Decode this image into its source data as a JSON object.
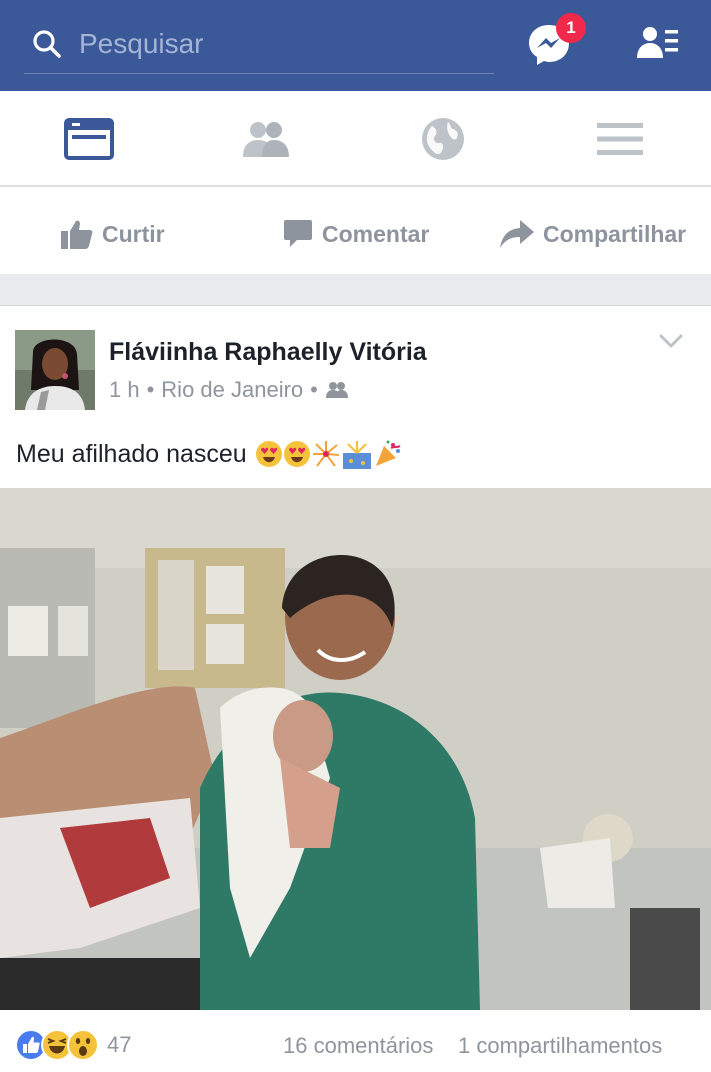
{
  "search": {
    "placeholder": "Pesquisar"
  },
  "header": {
    "messenger_badge": "1"
  },
  "nav": {
    "tabs": [
      "news-feed",
      "friend-requests",
      "notifications",
      "menu"
    ]
  },
  "actions": {
    "like": "Curtir",
    "comment": "Comentar",
    "share": "Compartilhar"
  },
  "post": {
    "author": "Fláviinha Raphaelly Vitória",
    "time": "1 h",
    "location": "Rio de Janeiro",
    "audience_icon": "friends-icon",
    "text": "Meu afilhado nasceu",
    "emojis": [
      "heart-eyes-emoji",
      "heart-eyes-emoji",
      "fireworks-emoji",
      "sparkler-emoji",
      "party-popper-emoji"
    ],
    "reaction_count": "47",
    "comments": "16 comentários",
    "shares": "1 compartilhamentos"
  },
  "colors": {
    "brand": "#3b5998",
    "badge": "#f02849",
    "muted": "#8d949e"
  }
}
